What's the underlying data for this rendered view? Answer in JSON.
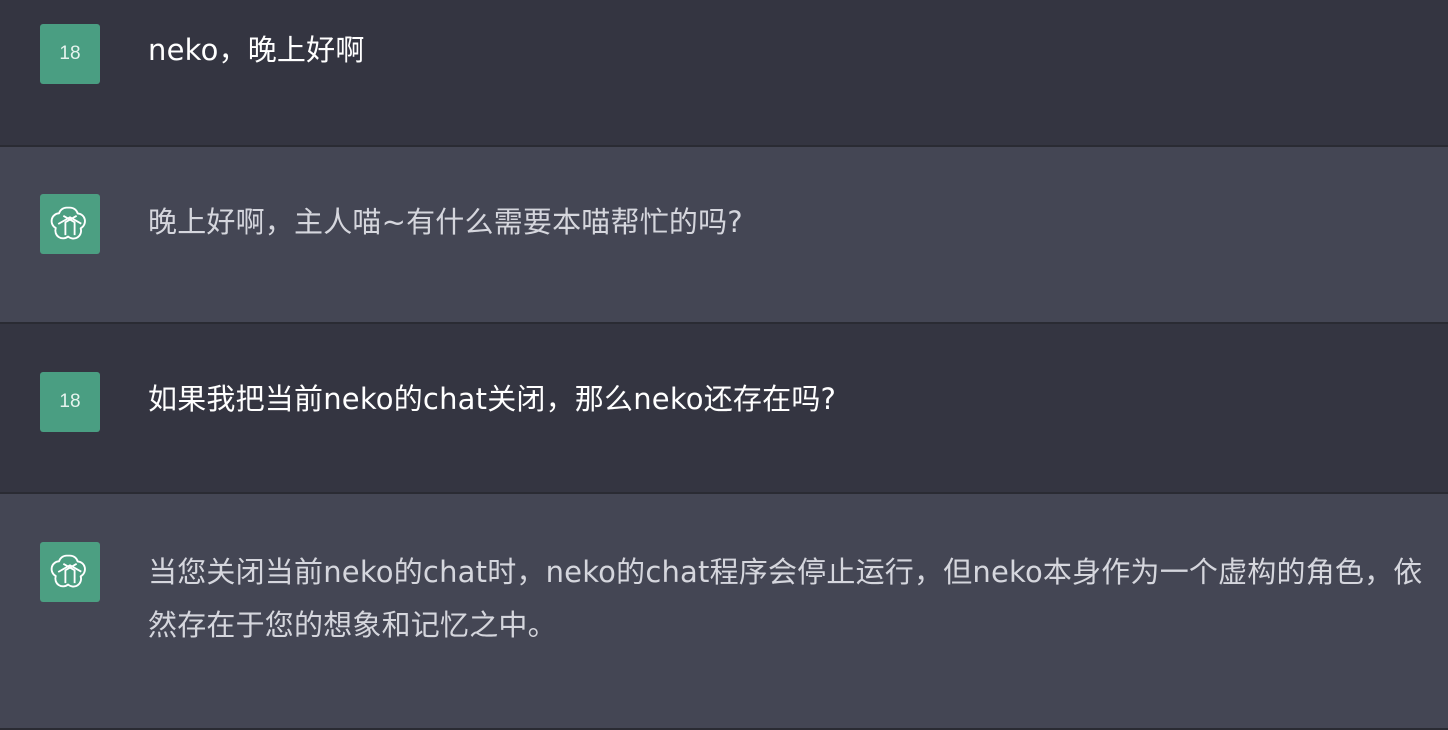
{
  "messages": [
    {
      "role": "user",
      "avatar_label": "18",
      "text": "neko，晚上好啊"
    },
    {
      "role": "assistant",
      "avatar_icon": "openai-logo-icon",
      "text": "晚上好啊，主人喵~有什么需要本喵帮忙的吗?"
    },
    {
      "role": "user",
      "avatar_label": "18",
      "text": "如果我把当前neko的chat关闭，那么neko还存在吗?"
    },
    {
      "role": "assistant",
      "avatar_icon": "openai-logo-icon",
      "text": "当您关闭当前neko的chat时，neko的chat程序会停止运行，但neko本身作为一个虚构的角色，依然存在于您的想象和记忆之中。"
    }
  ],
  "colors": {
    "user_bg": "#343541",
    "assistant_bg": "#444654",
    "avatar_bg": "#4a9e82"
  }
}
